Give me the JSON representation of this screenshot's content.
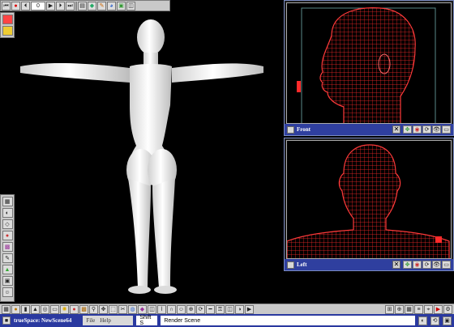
{
  "top_toolbar": {
    "frame_value": "0",
    "icons": [
      "rewind-icon",
      "record-icon",
      "step-back-icon",
      "frame-field",
      "play-icon",
      "step-forward-icon",
      "end-icon",
      "keyframe-icon",
      "path-icon",
      "tools-icon",
      "palette-icon",
      "cube-icon",
      "camera-icon"
    ]
  },
  "viewports": {
    "front": {
      "label": "Front"
    },
    "left": {
      "label": "Left"
    }
  },
  "status_bar": {
    "app_title": "trueSpace: NewScene64",
    "menu_file": "File",
    "menu_help": "Help",
    "shift_hint": "Shift S",
    "message": "Render Scene"
  },
  "colors": {
    "wire": "#ff2a2a",
    "statusbar": "#2a39a0",
    "titlebar": "#2f3f9f",
    "toolbar": "#c9c9c9"
  }
}
